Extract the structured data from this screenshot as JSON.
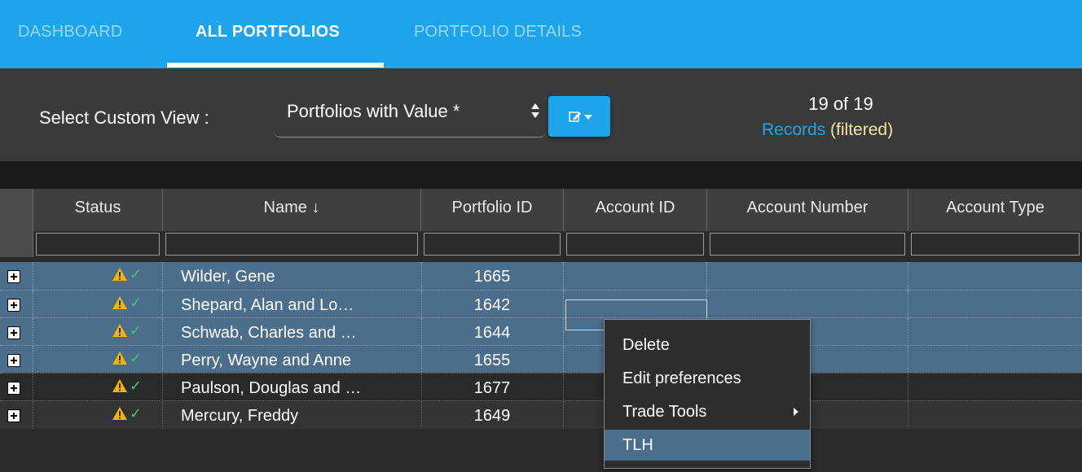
{
  "nav": {
    "tabs": [
      {
        "label": "DASHBOARD",
        "active": false
      },
      {
        "label": "ALL PORTFOLIOS",
        "active": true
      },
      {
        "label": "PORTFOLIO DETAILS",
        "active": false
      }
    ]
  },
  "toolbar": {
    "select_label": "Select Custom View :",
    "selected_view": "Portfolios with Value *",
    "records_count": "19 of 19",
    "records_link": "Records",
    "records_filter": "(filtered)"
  },
  "grid": {
    "columns": [
      "Status",
      "Name ↓",
      "Portfolio ID",
      "Account ID",
      "Account Number",
      "Account Type"
    ],
    "rows": [
      {
        "name": "Wilder, Gene",
        "portfolio_id": "1665",
        "selected": true
      },
      {
        "name": "Shepard, Alan and Lo…",
        "portfolio_id": "1642",
        "selected": true
      },
      {
        "name": "Schwab, Charles and …",
        "portfolio_id": "1644",
        "selected": true
      },
      {
        "name": "Perry, Wayne and Anne",
        "portfolio_id": "1655",
        "selected": true
      },
      {
        "name": "Paulson, Douglas and …",
        "portfolio_id": "1677",
        "selected": false
      },
      {
        "name": "Mercury, Freddy",
        "portfolio_id": "1649",
        "selected": false
      }
    ]
  },
  "context_menu": {
    "items": [
      "Delete",
      "Edit preferences",
      "Trade Tools",
      "TLH"
    ],
    "highlighted": "TLH"
  },
  "colors": {
    "accent": "#1ea4ea",
    "selected_row": "#4a6e8c",
    "warning": "#f5b400",
    "check": "#46c06a"
  }
}
